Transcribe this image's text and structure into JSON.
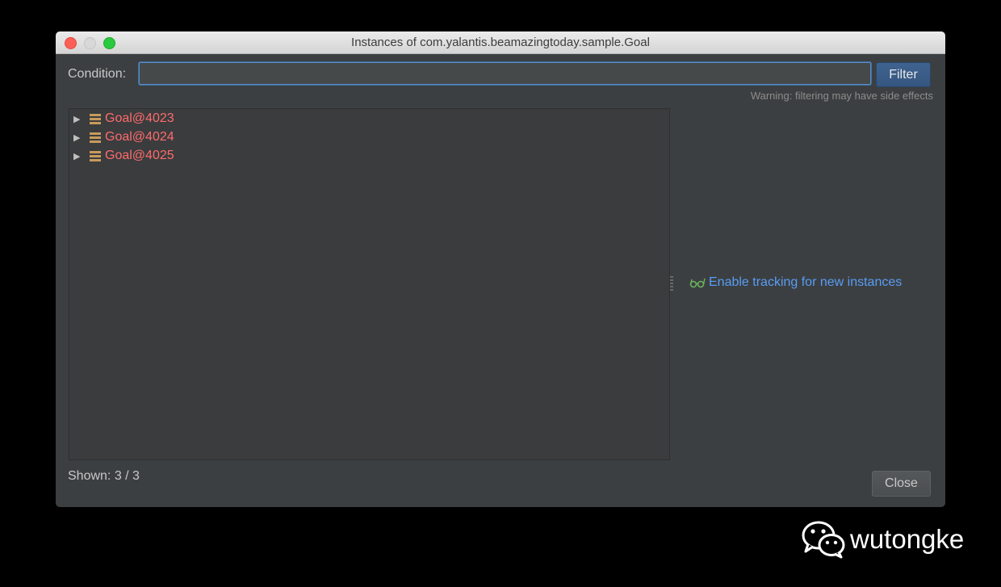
{
  "window": {
    "title": "Instances of com.yalantis.beamazingtoday.sample.Goal"
  },
  "condition": {
    "label": "Condition:",
    "value": "",
    "placeholder": ""
  },
  "filter_button": "Filter",
  "warning": "Warning: filtering may have side effects",
  "instances": [
    {
      "label": "Goal@4023",
      "icon": "object-icon",
      "expanded": false
    },
    {
      "label": "Goal@4024",
      "icon": "object-icon",
      "expanded": false
    },
    {
      "label": "Goal@4025",
      "icon": "object-icon",
      "expanded": false
    }
  ],
  "tracking_link": {
    "label": "Enable tracking for new instances",
    "icon": "glasses-icon"
  },
  "shown": "Shown: 3 / 3",
  "close_button": "Close",
  "watermark": {
    "text": "wutongke",
    "icon": "wechat-icon"
  },
  "colors": {
    "window_bg": "#3c3f41",
    "instance_label": "#ff6b6b",
    "link": "#589df6",
    "filter_button": "#3f6390"
  }
}
